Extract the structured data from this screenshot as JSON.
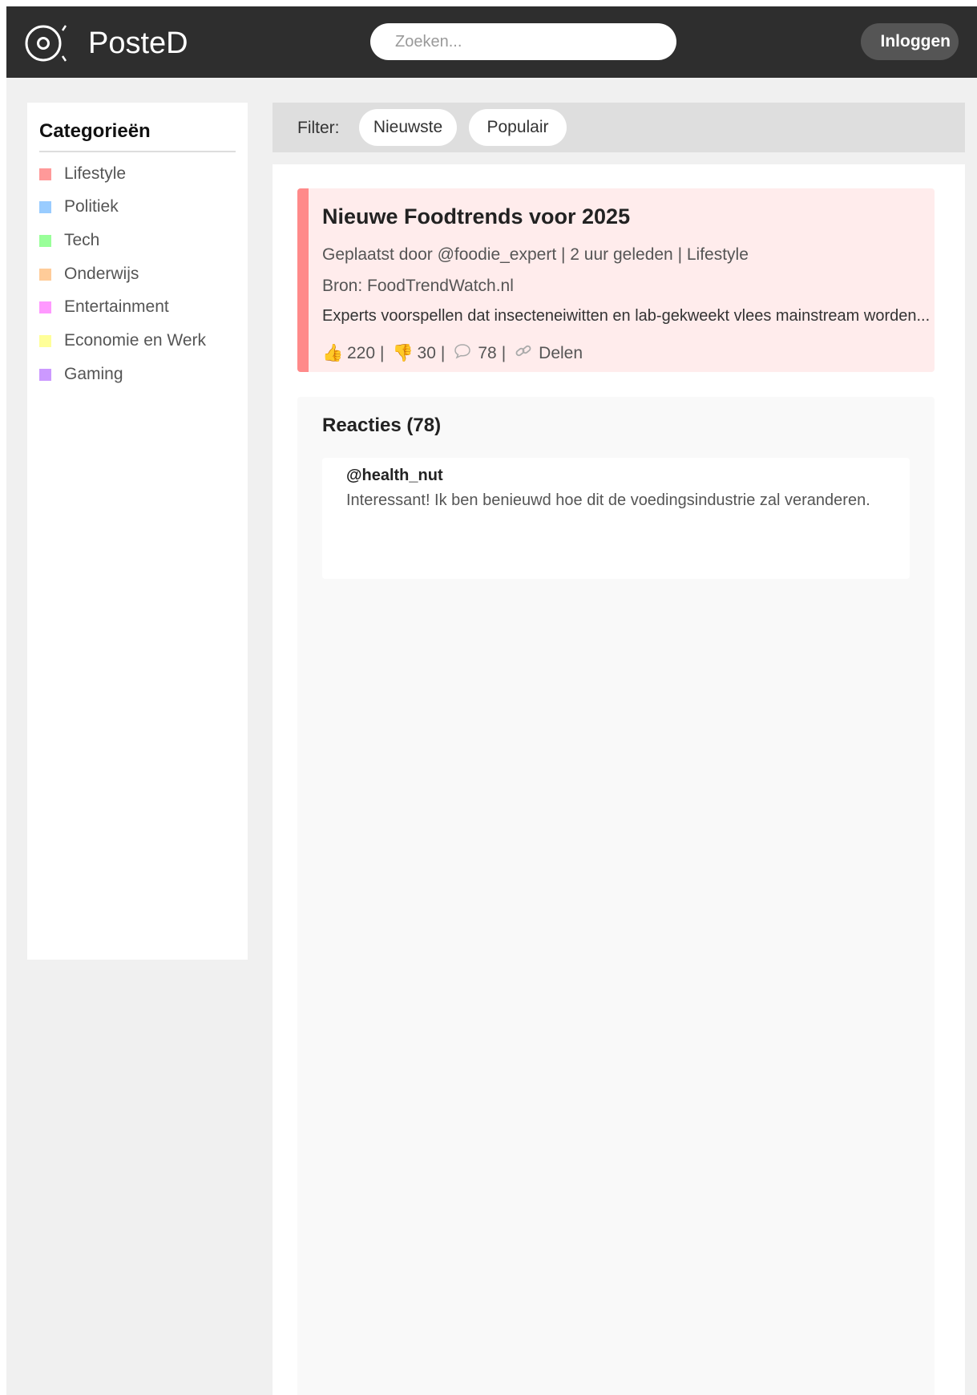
{
  "header": {
    "logo_text": "PosteD",
    "search_placeholder": "Zoeken...",
    "login_label": "Inloggen"
  },
  "sidebar": {
    "title": "Categorieën",
    "categories": [
      {
        "label": "Lifestyle",
        "color": "#ff9999"
      },
      {
        "label": "Politiek",
        "color": "#99ccff"
      },
      {
        "label": "Tech",
        "color": "#99ff99"
      },
      {
        "label": "Onderwijs",
        "color": "#ffcc99"
      },
      {
        "label": "Entertainment",
        "color": "#ff99ff"
      },
      {
        "label": "Economie en Werk",
        "color": "#ffff99"
      },
      {
        "label": "Gaming",
        "color": "#cc99ff"
      }
    ]
  },
  "filter": {
    "label": "Filter:",
    "options": [
      "Nieuwste",
      "Populair"
    ]
  },
  "post": {
    "title": "Nieuwe Foodtrends voor 2025",
    "meta": "Geplaatst door @foodie_expert | 2 uur geleden | Lifestyle",
    "source": "Bron: FoodTrendWatch.nl",
    "excerpt": "Experts voorspellen dat insecteneiwitten en lab-gekweekt vlees mainstream worden...",
    "likes": "220",
    "dislikes": "30",
    "comments": "78",
    "share_label": "Delen",
    "accent_color": "#ff8a8a",
    "icons": {
      "like": "thumbs-up-icon",
      "dislike": "thumbs-down-icon",
      "comment": "speech-bubble-icon",
      "share": "link-icon"
    }
  },
  "comments": {
    "heading": "Reacties (78)",
    "items": [
      {
        "author": "@health_nut",
        "text": "Interessant! Ik ben benieuwd hoe dit de voedingsindustrie zal veranderen."
      }
    ]
  }
}
